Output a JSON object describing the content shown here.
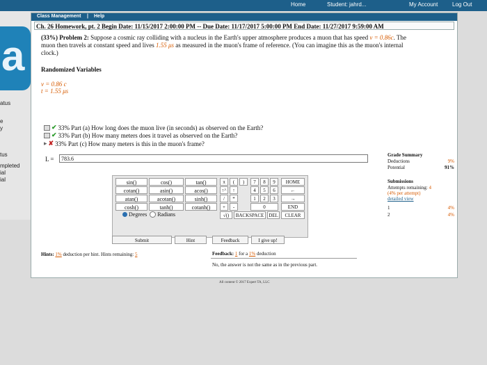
{
  "top_nav": {
    "home": "Home",
    "student": "Student: jahrd...",
    "my_account": "My Account",
    "log_out": "Log Out"
  },
  "left_panel": {
    "logo_letter": "a",
    "labels": [
      "atus",
      "e",
      "y",
      "tus",
      "mpleted",
      "ial",
      "ial"
    ]
  },
  "menubar": {
    "class_management": "Class Management",
    "separator": "|",
    "help": "Help"
  },
  "hw_title": "Ch. 26 Homework, pt. 2 Begin Date: 11/15/2017 2:00:00 PM -- Due Date: 11/17/2017 5:00:00 PM End Date: 11/27/2017 9:59:00 AM",
  "problem": {
    "percent": "(33%)",
    "label": "Problem 2:",
    "text1": "Suppose a cosmic ray colliding with a nucleus in the Earth's upper atmosphere produces a muon that has speed",
    "v_expr": "v = 0.86c",
    "text2": ". The muon then travels at constant speed and lives",
    "t_expr": "1.55 μs",
    "text3": "as measured in the muon's frame of reference. (You can imagine this as the muon's internal clock.)"
  },
  "randomized": {
    "heading": "Randomized Variables",
    "v": "v = 0.86 c",
    "t": "t = 1.55 μs"
  },
  "parts": [
    {
      "status": "✔",
      "text": "33% Part (a)  How long does the muon live (in seconds) as observed on the Earth?"
    },
    {
      "status": "✔",
      "text": "33% Part (b)  How many meters does it travel as observed on the Earth?"
    },
    {
      "status": "✘",
      "text": "33% Part (c)  How many meters is this in the muon's frame?"
    }
  ],
  "answer": {
    "label": "L =",
    "value": "783.6"
  },
  "calculator": {
    "functions": [
      [
        "sin()",
        "cos()",
        "tan()"
      ],
      [
        "cotan()",
        "asin()",
        "acos()"
      ],
      [
        "atan()",
        "acotan()",
        "sinh()"
      ],
      [
        "cosh()",
        "tanh()",
        "cotanh()"
      ]
    ],
    "degrees": "Degrees",
    "radians": "Radians",
    "keys": {
      "pi": "π",
      "lparen": "(",
      "rparen": ")",
      "up": "↑^",
      "up_arrow": "↑",
      "slash": "/",
      "times": "*",
      "plus": "+",
      "minus": "-",
      "sqrt": "√()",
      "digits": [
        "7",
        "8",
        "9",
        "4",
        "5",
        "6",
        "1",
        "2",
        "3",
        "0",
        "."
      ],
      "home": "HOME",
      "left": "←",
      "right": "→",
      "end": "END",
      "backspace": "BACKSPACE",
      "del": "DEL",
      "clear": "CLEAR"
    }
  },
  "actions": {
    "submit": "Submit",
    "hint": "Hint",
    "feedback": "Feedback",
    "give_up": "I give up!"
  },
  "hints": {
    "prefix": "Hints:",
    "pct": "1%",
    "middle": "deduction per hint. Hints remaining:",
    "remaining": "5"
  },
  "feedback": {
    "prefix": "Feedback:",
    "count": "1",
    "middle": "for a",
    "pct": "1%",
    "suffix": "deduction"
  },
  "message": "No, the answer is not the same as in the previous part.",
  "copyright": "All content © 2017 Expert TA, LLC",
  "grade_summary": {
    "heading": "Grade Summary",
    "deductions_label": "Deductions",
    "deductions_value": "9%",
    "potential_label": "Potential",
    "potential_value": "91%",
    "submissions_heading": "Submissions",
    "attempts_text": "Attempts remaining:",
    "attempts_value": "4",
    "per_attempt": "(4% per attempt)",
    "detailed_view": "detailed view",
    "rows": [
      {
        "n": "1",
        "v": "4%"
      },
      {
        "n": "2",
        "v": "4%"
      }
    ]
  }
}
